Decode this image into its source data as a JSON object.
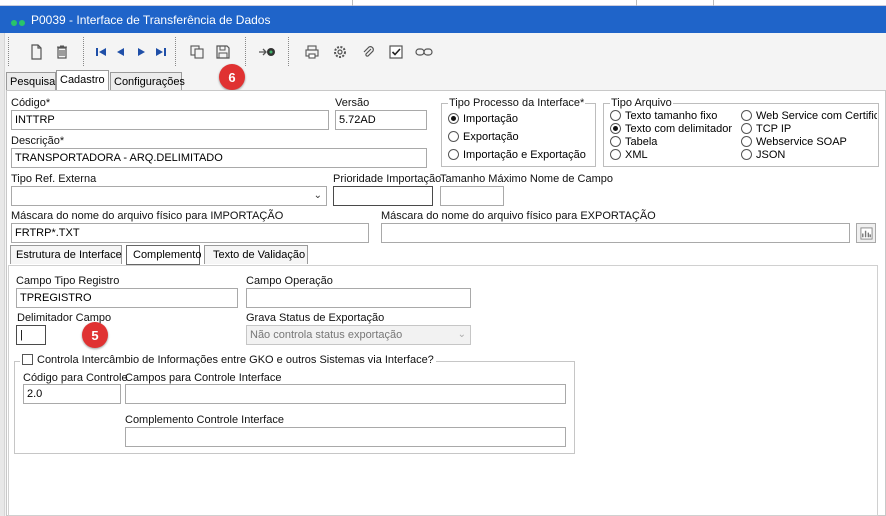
{
  "window": {
    "code": "P0039",
    "title": "P0039 - Interface de Transferência de Dados"
  },
  "toolbar": {
    "buttons": [
      "new-icon",
      "delete-icon",
      "first-icon",
      "prev-icon",
      "next-icon",
      "last-icon",
      "copy-icon",
      "save-icon",
      "search-record-icon",
      "print-icon",
      "settings-icon",
      "attach-icon",
      "check-icon",
      "link-icon"
    ]
  },
  "tabs": [
    "Pesquisa",
    "Cadastro",
    "Configurações"
  ],
  "badges": {
    "toolbar_step": "6",
    "field_step": "5"
  },
  "form": {
    "codigo_label": "Código*",
    "codigo_value": "INTTRP",
    "versao_label": "Versão",
    "versao_value": "5.72AD",
    "descricao_label": "Descrição*",
    "descricao_value": "TRANSPORTADORA - ARQ.DELIMITADO",
    "tipo_ref_label": "Tipo Ref. Externa",
    "tipo_ref_value": "",
    "prioridade_label": "Prioridade Importação",
    "prioridade_value": "",
    "tamanho_label": "Tamanho Máximo Nome de Campo",
    "tamanho_value": "",
    "mascara_imp_label": "Máscara do nome do arquivo físico para IMPORTAÇÃO",
    "mascara_imp_value": "FRTRP*.TXT",
    "mascara_exp_label": "Máscara do nome do arquivo físico para EXPORTAÇÃO",
    "mascara_exp_value": ""
  },
  "tipo_processo": {
    "label": "Tipo Processo da Interface*",
    "options": [
      "Importação",
      "Exportação",
      "Importação e Exportação"
    ],
    "selected": "Importação"
  },
  "tipo_arquivo": {
    "label": "Tipo Arquivo",
    "col1": [
      "Texto tamanho fixo",
      "Texto com delimitador",
      "Tabela",
      "XML"
    ],
    "col2": [
      "Web Service com Certifica",
      "TCP IP",
      "Webservice SOAP",
      "JSON"
    ],
    "selected": "Texto com delimitador"
  },
  "subtabs": [
    "Estrutura de Interface",
    "Complemento",
    "Texto de Validação"
  ],
  "complemento": {
    "campo_tipo_registro_label": "Campo Tipo Registro",
    "campo_tipo_registro_value": "TPREGISTRO",
    "campo_operacao_label": "Campo Operação",
    "campo_operacao_value": "",
    "delimitador_label": "Delimitador Campo",
    "delimitador_value": "|",
    "grava_status_label": "Grava Status de Exportação",
    "grava_status_value": "Não controla status exportação",
    "controla_label": "Controla Intercâmbio de Informações entre GKO e outros Sistemas via Interface?",
    "codigo_controle_label": "Código para Controle",
    "codigo_controle_value": "2.0",
    "campos_controle_label": "Campos para Controle Interface",
    "campos_controle_value": "",
    "complemento_controle_label": "Complemento Controle Interface",
    "complemento_controle_value": ""
  }
}
